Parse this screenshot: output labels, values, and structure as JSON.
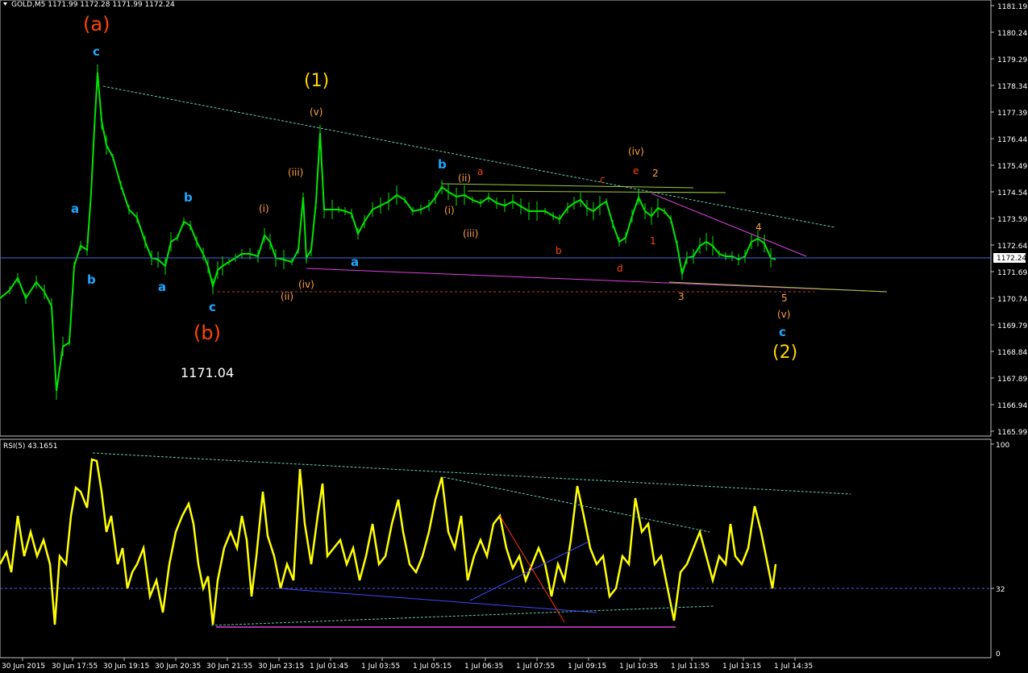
{
  "header": {
    "symbol_line": "GOLD,M5 1171.99 1172.28 1171.99 1172.24"
  },
  "rsi_header": "RSI(5) 43.1651",
  "price_axis": [
    "1181.19",
    "1180.24",
    "1179.29",
    "1178.34",
    "1177.39",
    "1176.44",
    "1175.49",
    "1174.54",
    "1173.59",
    "1172.64",
    "1171.69",
    "1170.74",
    "1169.79",
    "1168.84",
    "1167.89",
    "1166.94",
    "1165.99"
  ],
  "current_price": "1172.24",
  "rsi_axis": [
    "100",
    "32",
    "0"
  ],
  "time_axis": [
    "30 Jun 2015",
    "30 Jun 17:55",
    "30 Jun 19:15",
    "30 Jun 20:35",
    "30 Jun 21:55",
    "30 Jun 23:15",
    "1 Jul 01:45",
    "1 Jul 03:55",
    "1 Jul 05:15",
    "1 Jul 06:35",
    "1 Jul 07:55",
    "1 Jul 09:15",
    "1 Jul 10:35",
    "1 Jul 11:55",
    "1 Jul 13:15",
    "1 Jul 14:35"
  ],
  "colors": {
    "bull": "#00e600",
    "rsi": "#ffff00",
    "wave_blue": "#1ea7ff",
    "wave_orange": "#ff4500",
    "wave_gold": "#ffd700",
    "wave_light": "#ff9f40",
    "trend_teal": "#5fcfb0",
    "trend_magenta": "#e040e0",
    "trend_yellowgreen": "#9acd32",
    "support_red": "#cc3333",
    "rsi_line_blue": "#4444ff"
  },
  "annotations": [
    {
      "t": "(a)",
      "c": "wave_orange",
      "s": 24
    },
    {
      "t": "c",
      "c": "wave_blue",
      "s": 15
    },
    {
      "t": "a",
      "c": "wave_blue",
      "s": 15
    },
    {
      "t": "b",
      "c": "wave_blue",
      "s": 15
    },
    {
      "t": "b",
      "c": "wave_blue",
      "s": 15
    },
    {
      "t": "a",
      "c": "wave_blue",
      "s": 15
    },
    {
      "t": "c",
      "c": "wave_blue",
      "s": 15
    },
    {
      "t": "(b)",
      "c": "wave_orange",
      "s": 24
    },
    {
      "t": "1171.04",
      "c": "white",
      "s": 16
    },
    {
      "t": "(1)",
      "c": "wave_gold",
      "s": 22
    },
    {
      "t": "(v)",
      "c": "wave_light",
      "s": 12
    },
    {
      "t": "(iii)",
      "c": "wave_light",
      "s": 12
    },
    {
      "t": "(i)",
      "c": "wave_light",
      "s": 12
    },
    {
      "t": "(iv)",
      "c": "wave_light",
      "s": 12
    },
    {
      "t": "(ii)",
      "c": "wave_light",
      "s": 12
    },
    {
      "t": "a",
      "c": "wave_blue",
      "s": 15
    },
    {
      "t": "b",
      "c": "wave_blue",
      "s": 15
    },
    {
      "t": "(ii)",
      "c": "wave_light",
      "s": 12
    },
    {
      "t": "a",
      "c": "wave_orange",
      "s": 12
    },
    {
      "t": "(i)",
      "c": "wave_light",
      "s": 12
    },
    {
      "t": "(iii)",
      "c": "wave_light",
      "s": 12
    },
    {
      "t": "b",
      "c": "wave_orange",
      "s": 12
    },
    {
      "t": "c",
      "c": "wave_orange",
      "s": 12
    },
    {
      "t": "d",
      "c": "wave_orange",
      "s": 12
    },
    {
      "t": "(iv)",
      "c": "wave_light",
      "s": 12
    },
    {
      "t": "e",
      "c": "wave_orange",
      "s": 12
    },
    {
      "t": "2",
      "c": "wave_light",
      "s": 12
    },
    {
      "t": "1",
      "c": "wave_orange",
      "s": 12
    },
    {
      "t": "3",
      "c": "wave_light",
      "s": 12
    },
    {
      "t": "4",
      "c": "wave_light",
      "s": 12
    },
    {
      "t": "5",
      "c": "wave_light",
      "s": 12
    },
    {
      "t": "(v)",
      "c": "wave_light",
      "s": 12
    },
    {
      "t": "c",
      "c": "wave_blue",
      "s": 15
    },
    {
      "t": "(2)",
      "c": "wave_gold",
      "s": 22
    }
  ],
  "chart_data": [
    {
      "type": "line",
      "symbol": "GOLD",
      "timeframe": "M5",
      "ylim": [
        1165.99,
        1181.19
      ],
      "x": [
        "30 Jun 2015",
        "30 Jun 17:55",
        "30 Jun 19:15",
        "30 Jun 20:35",
        "30 Jun 21:55",
        "30 Jun 23:15",
        "1 Jul 01:45",
        "1 Jul 03:55",
        "1 Jul 05:15",
        "1 Jul 06:35",
        "1 Jul 07:55",
        "1 Jul 09:15",
        "1 Jul 10:35",
        "1 Jul 11:55",
        "1 Jul 13:15",
        "1 Jul 14:35"
      ],
      "series": [
        {
          "name": "GOLD,M5",
          "values": [
            1172.1,
            1170.0,
            1172.7,
            1172.5,
            1172.3,
            1172.9,
            1173.9,
            1174.1,
            1174.6,
            1174.4,
            1174.3,
            1173.9,
            1174.3,
            1172.5,
            1172.6,
            1172.24
          ]
        }
      ],
      "key_points": {
        "high": 1178.9,
        "low": 1166.7,
        "last": 1172.24
      }
    },
    {
      "type": "line",
      "ylim": [
        0,
        100
      ],
      "x": [
        "30 Jun 2015",
        "30 Jun 17:55",
        "30 Jun 19:15",
        "30 Jun 20:35",
        "30 Jun 21:55",
        "30 Jun 23:15",
        "1 Jul 01:45",
        "1 Jul 03:55",
        "1 Jul 05:15",
        "1 Jul 06:35",
        "1 Jul 07:55",
        "1 Jul 09:15",
        "1 Jul 10:35",
        "1 Jul 11:55",
        "1 Jul 13:15",
        "1 Jul 14:35"
      ],
      "series": [
        {
          "name": "RSI(5)",
          "values": [
            50,
            92,
            40,
            70,
            15,
            85,
            95,
            50,
            88,
            40,
            60,
            80,
            65,
            60,
            70,
            43.17
          ]
        }
      ],
      "levels": [
        32
      ]
    }
  ]
}
